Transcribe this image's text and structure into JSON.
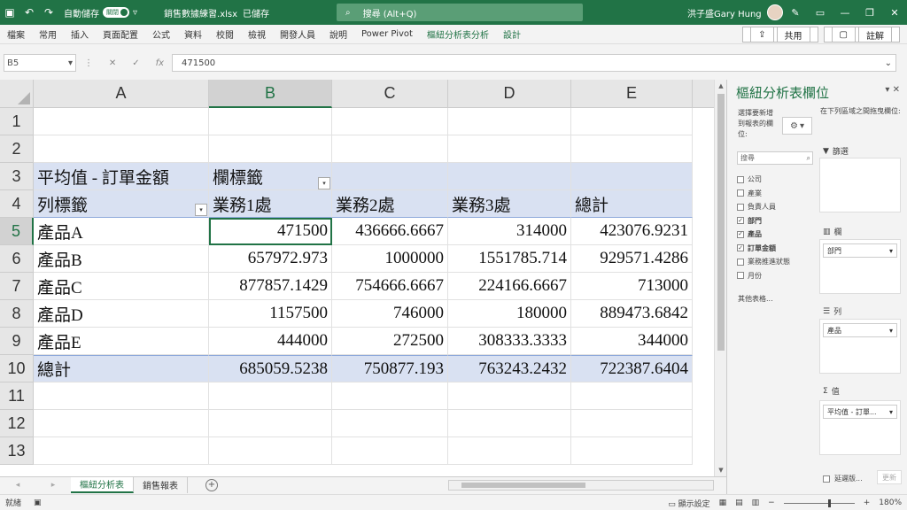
{
  "titlebar": {
    "autosave_label": "自動儲存",
    "autosave_state": "關閉",
    "filename": "銷售數據練習.xlsx",
    "saved_status": "已儲存",
    "search_placeholder": "搜尋 (Alt+Q)",
    "user_name": "洪子盛Gary Hung"
  },
  "menu": {
    "items": [
      "檔案",
      "常用",
      "插入",
      "頁面配置",
      "公式",
      "資料",
      "校閱",
      "檢視",
      "開發人員",
      "說明",
      "Power Pivot",
      "樞紐分析表分析",
      "設計"
    ],
    "share": "共用",
    "comment": "註解"
  },
  "formulabar": {
    "cell_ref": "B5",
    "value": "471500"
  },
  "grid": {
    "columns": [
      "A",
      "B",
      "C",
      "D",
      "E"
    ],
    "rows": [
      "1",
      "2",
      "3",
      "4",
      "5",
      "6",
      "7",
      "8",
      "9",
      "10",
      "11",
      "12",
      "13"
    ],
    "pivot": {
      "value_label": "平均值 - 訂單金額",
      "col_label": "欄標籤",
      "row_label": "列標籤",
      "col_headers": [
        "業務1處",
        "業務2處",
        "業務3處",
        "總計"
      ],
      "data_rows": [
        {
          "name": "產品A",
          "vals": [
            "471500",
            "436666.6667",
            "314000",
            "423076.9231"
          ]
        },
        {
          "name": "產品B",
          "vals": [
            "657972.973",
            "1000000",
            "1551785.714",
            "929571.4286"
          ]
        },
        {
          "name": "產品C",
          "vals": [
            "877857.1429",
            "754666.6667",
            "224166.6667",
            "713000"
          ]
        },
        {
          "name": "產品D",
          "vals": [
            "1157500",
            "746000",
            "180000",
            "889473.6842"
          ]
        },
        {
          "name": "產品E",
          "vals": [
            "444000",
            "272500",
            "308333.3333",
            "344000"
          ]
        }
      ],
      "total_row": {
        "name": "總計",
        "vals": [
          "685059.5238",
          "750877.193",
          "763243.2432",
          "722387.6404"
        ]
      }
    }
  },
  "sheets": {
    "tabs": [
      "樞紐分析表",
      "銷售報表"
    ],
    "active": 0
  },
  "status": {
    "ready": "就緒",
    "display_settings": "顯示設定",
    "zoom": "180%"
  },
  "pivot_panel": {
    "title": "樞紐分析表欄位",
    "choose_text": "選擇要新增到報表的欄位:",
    "drag_text": "在下列區域之間拖曳欄位:",
    "search_placeholder": "搜尋",
    "fields": [
      {
        "name": "公司",
        "checked": false
      },
      {
        "name": "產業",
        "checked": false
      },
      {
        "name": "負責人員",
        "checked": false
      },
      {
        "name": "部門",
        "checked": true
      },
      {
        "name": "產品",
        "checked": true
      },
      {
        "name": "訂單金額",
        "checked": true
      },
      {
        "name": "業務推進狀態",
        "checked": false
      },
      {
        "name": "月份",
        "checked": false
      }
    ],
    "more_tables": "其他表格...",
    "zones": {
      "filters": "篩選",
      "columns": "欄",
      "columns_item": "部門",
      "rows": "列",
      "rows_item": "產品",
      "values": "值",
      "values_item": "平均值 - 訂單..."
    },
    "defer": "延遲版...",
    "update": "更新"
  }
}
